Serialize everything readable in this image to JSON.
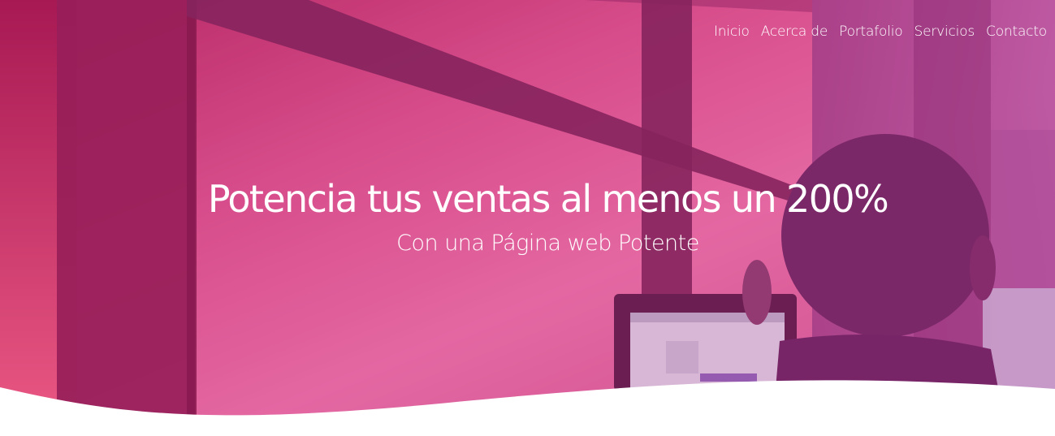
{
  "nav": {
    "items": [
      {
        "label": "Inicio"
      },
      {
        "label": "Acerca de"
      },
      {
        "label": "Portafolio"
      },
      {
        "label": "Servicios"
      },
      {
        "label": "Contacto"
      }
    ]
  },
  "hero": {
    "title": "Potencia tus ventas al menos un 200%",
    "subtitle": "Con una Página web Potente",
    "overlay_color": "#d4387f",
    "accent_colors": [
      "#e8508a",
      "#8e1c57",
      "#c45aa8"
    ]
  }
}
